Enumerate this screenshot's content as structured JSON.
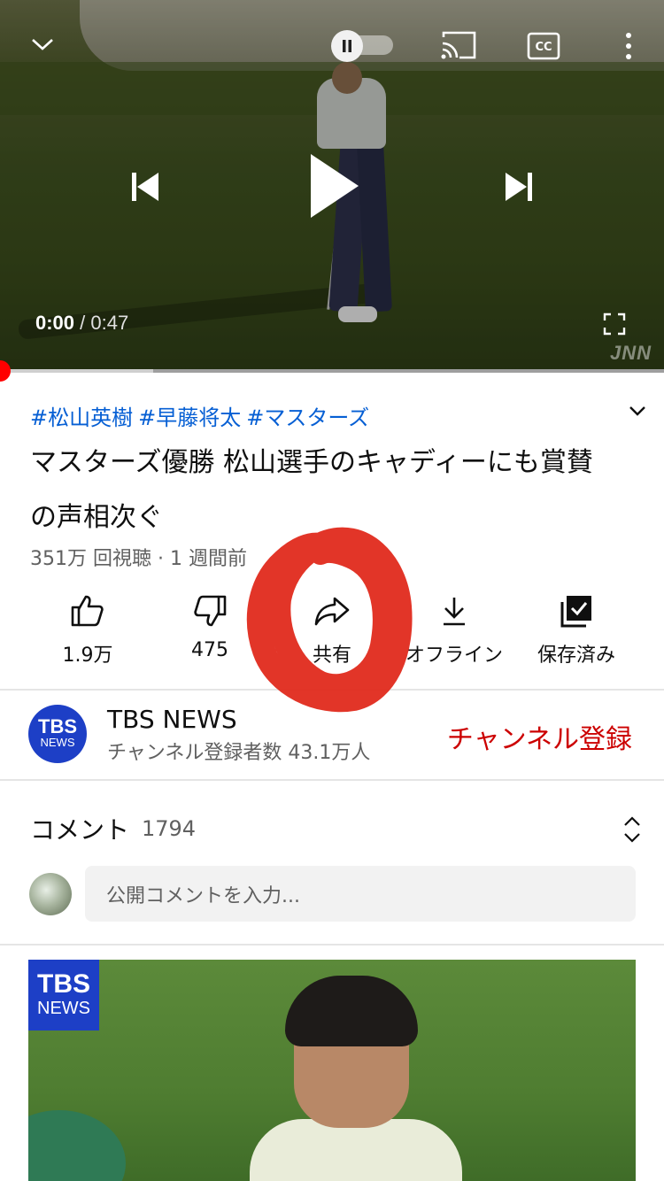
{
  "player": {
    "current_time": "0:00",
    "separator": "/",
    "duration": "0:47",
    "watermark": "JNN",
    "progress_fraction": 0.0,
    "buffered_fraction": 0.23
  },
  "video": {
    "hashtags": [
      "#松山英樹",
      "#早藤将太",
      "#マスターズ"
    ],
    "title": "マスターズ優勝 松山選手のキャディーにも賞賛の声相次ぐ",
    "views": "351万 回視聴",
    "meta_separator": "·",
    "age": "1 週間前"
  },
  "actions": [
    {
      "label": "1.9万",
      "icon": "thumbs-up-icon"
    },
    {
      "label": "475",
      "icon": "thumbs-down-icon"
    },
    {
      "label": "共有",
      "icon": "share-icon"
    },
    {
      "label": "オフライン",
      "icon": "download-icon"
    },
    {
      "label": "保存済み",
      "icon": "saved-playlist-icon"
    }
  ],
  "channel": {
    "name": "TBS NEWS",
    "subscribers": "チャンネル登録者数 43.1万人",
    "subscribe_label": "チャンネル登録",
    "avatar_line1": "TBS",
    "avatar_line2": "NEWS"
  },
  "comments": {
    "title": "コメント",
    "count": "1794",
    "placeholder": "公開コメントを入力..."
  },
  "next_thumbnail": {
    "logo_line1": "TBS",
    "logo_line2": "NEWS"
  },
  "colors": {
    "accent_red": "#ff0000",
    "subscribe_red": "#cc0000",
    "hashtag_blue": "#065fd4",
    "annotation_red": "#e02a1c"
  }
}
